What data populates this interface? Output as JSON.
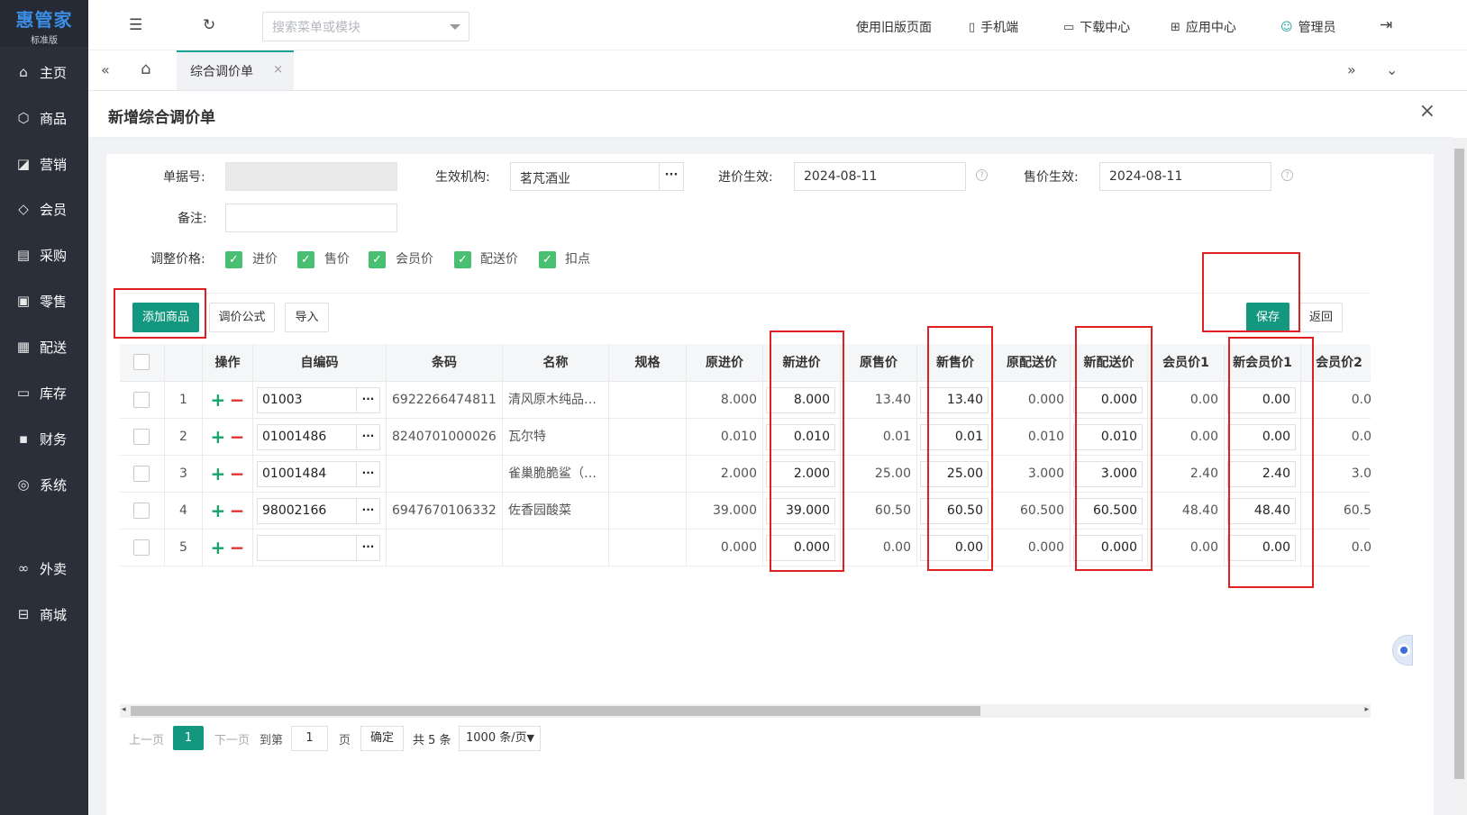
{
  "app": {
    "logo": "惠管家",
    "edition": "标准版"
  },
  "sidebar": {
    "items": [
      {
        "label": "主页",
        "icon": "home-icon"
      },
      {
        "label": "商品",
        "icon": "box-icon"
      },
      {
        "label": "营销",
        "icon": "chart-icon"
      },
      {
        "label": "会员",
        "icon": "diamond-icon"
      },
      {
        "label": "采购",
        "icon": "cart-icon"
      },
      {
        "label": "零售",
        "icon": "bag-icon"
      },
      {
        "label": "配送",
        "icon": "truck-icon"
      },
      {
        "label": "库存",
        "icon": "warehouse-icon"
      },
      {
        "label": "财务",
        "icon": "wallet-icon"
      },
      {
        "label": "系统",
        "icon": "gear-icon"
      },
      {
        "label": "外卖",
        "icon": "delivery-icon"
      },
      {
        "label": "商城",
        "icon": "store-icon"
      }
    ]
  },
  "topbar": {
    "search_placeholder": "搜索菜单或模块",
    "links": [
      "使用旧版页面",
      "手机端",
      "下载中心",
      "应用中心",
      "管理员"
    ]
  },
  "tabs": [
    {
      "label": "综合调价单"
    }
  ],
  "page": {
    "title": "新增综合调价单"
  },
  "form": {
    "doc_no_label": "单据号:",
    "org_label": "生效机构:",
    "org_value": "茗芃酒业",
    "purchase_effect_label": "进价生效:",
    "purchase_effect_value": "2024-08-11",
    "sale_effect_label": "售价生效:",
    "sale_effect_value": "2024-08-11",
    "remark_label": "备注:",
    "adjust_label": "调整价格:",
    "adjust_options": [
      "进价",
      "售价",
      "会员价",
      "配送价",
      "扣点"
    ]
  },
  "toolbar": {
    "add": "添加商品",
    "formula": "调价公式",
    "import": "导入",
    "save": "保存",
    "back": "返回"
  },
  "table": {
    "headers": [
      "操作",
      "自编码",
      "条码",
      "名称",
      "规格",
      "原进价",
      "新进价",
      "原售价",
      "新售价",
      "原配送价",
      "新配送价",
      "会员价1",
      "新会员价1",
      "会员价2"
    ],
    "rows": [
      {
        "no": "1",
        "code": "01003",
        "barcode": "6922266474811",
        "name": "清风原木纯品…",
        "spec": "",
        "old_in": "8.000",
        "new_in": "8.000",
        "old_sale": "13.40",
        "new_sale": "13.40",
        "old_dist": "0.000",
        "new_dist": "0.000",
        "mem1": "0.00",
        "new_mem1": "0.00",
        "mem2": "0.0"
      },
      {
        "no": "2",
        "code": "01001486",
        "barcode": "8240701000026",
        "name": "瓦尔特",
        "spec": "",
        "old_in": "0.010",
        "new_in": "0.010",
        "old_sale": "0.01",
        "new_sale": "0.01",
        "old_dist": "0.010",
        "new_dist": "0.010",
        "mem1": "0.00",
        "new_mem1": "0.00",
        "mem2": "0.0"
      },
      {
        "no": "3",
        "code": "01001484",
        "barcode": "",
        "name": "雀巢脆脆鲨（…",
        "spec": "",
        "old_in": "2.000",
        "new_in": "2.000",
        "old_sale": "25.00",
        "new_sale": "25.00",
        "old_dist": "3.000",
        "new_dist": "3.000",
        "mem1": "2.40",
        "new_mem1": "2.40",
        "mem2": "3.0"
      },
      {
        "no": "4",
        "code": "98002166",
        "barcode": "6947670106332",
        "name": "佐香园酸菜",
        "spec": "",
        "old_in": "39.000",
        "new_in": "39.000",
        "old_sale": "60.50",
        "new_sale": "60.50",
        "old_dist": "60.500",
        "new_dist": "60.500",
        "mem1": "48.40",
        "new_mem1": "48.40",
        "mem2": "60.5"
      },
      {
        "no": "5",
        "code": "",
        "barcode": "",
        "name": "",
        "spec": "",
        "old_in": "0.000",
        "new_in": "0.000",
        "old_sale": "0.00",
        "new_sale": "0.00",
        "old_dist": "0.000",
        "new_dist": "0.000",
        "mem1": "0.00",
        "new_mem1": "0.00",
        "mem2": "0.0"
      }
    ]
  },
  "pager": {
    "prev": "上一页",
    "page": "1",
    "next": "下一页",
    "goto": "到第",
    "goto_value": "1",
    "page_unit": "页",
    "confirm": "确定",
    "total": "共 5 条",
    "size": "1000 条/页"
  },
  "colors": {
    "primary": "#14977f",
    "sidebar": "#2b2f3a",
    "highlight": "#e02020"
  }
}
